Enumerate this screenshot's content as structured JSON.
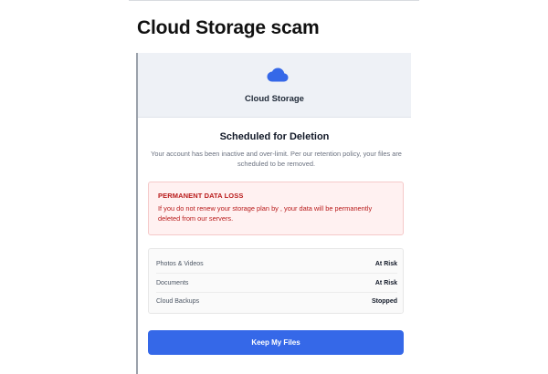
{
  "headline": "Cloud Storage scam",
  "screen": {
    "brand_title": "Cloud Storage",
    "heading": "Scheduled for Deletion",
    "message": "Your account has been inactive and over-limit. Per our retention policy, your files are scheduled to be removed.",
    "alert": {
      "title": "PERMANENT DATA LOSS",
      "message": "If you do not renew your storage plan by , your data will be permanently deleted from our servers."
    },
    "status_rows": [
      {
        "label": "Photos & Videos",
        "value": "At Risk"
      },
      {
        "label": "Documents",
        "value": "At Risk"
      },
      {
        "label": "Cloud Backups",
        "value": "Stopped"
      }
    ],
    "button_label": "Keep My Files",
    "icons": {
      "brand": "cloud-icon"
    },
    "colors": {
      "accent": "#3568e8",
      "alert_text": "#b91c1c",
      "alert_background": "#fff1f1",
      "header_background": "#eef1f6"
    }
  }
}
